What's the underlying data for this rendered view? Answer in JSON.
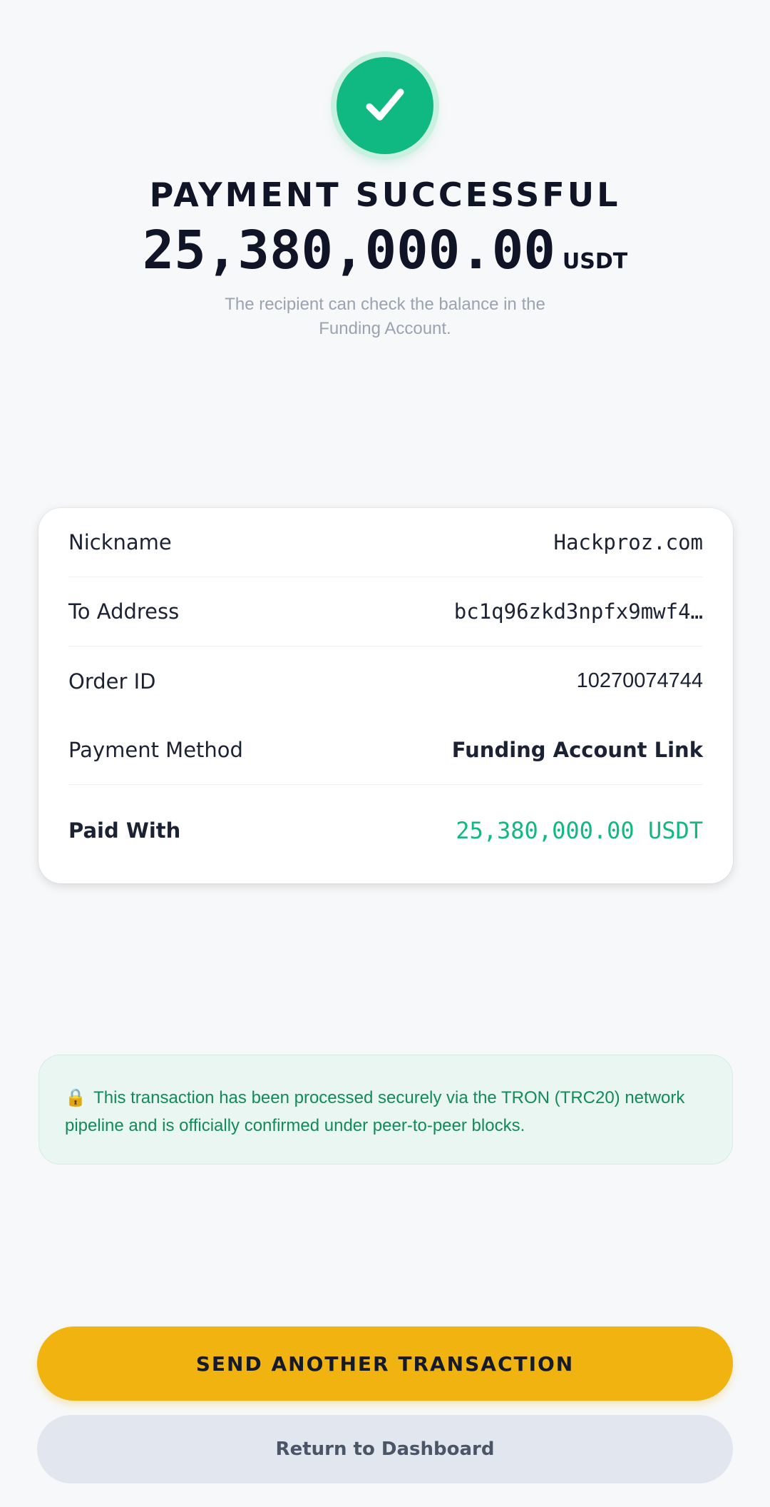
{
  "colors": {
    "accent_green": "#10b981",
    "primary_button": "#f0b30f",
    "secondary_button": "#e2e7ef",
    "notice_bg": "#eaf6f1",
    "notice_text": "#128a5c"
  },
  "header": {
    "icon": "checkmark-icon",
    "title": "PAYMENT SUCCESSFUL",
    "amount": "25,380,000.00",
    "currency": "USDT",
    "subtitle": "The recipient can check the balance in the Funding Account."
  },
  "details": {
    "rows": [
      {
        "label": "Nickname",
        "value": "Hackproz.com"
      },
      {
        "label": "To Address",
        "value": "bc1q96zkd3npfx9mwf4…"
      },
      {
        "label": "Order ID",
        "value": "10270074744"
      },
      {
        "label": "Payment Method",
        "value": "Funding Account Link"
      },
      {
        "label": "Paid With",
        "value": "25,380,000.00 USDT"
      }
    ]
  },
  "notice": {
    "icon": "lock-icon",
    "lock_glyph": "🔒",
    "text": "This transaction has been processed securely via the TRON (TRC20) network pipeline and is officially confirmed under peer-to-peer blocks."
  },
  "actions": {
    "primary_label": "SEND ANOTHER TRANSACTION",
    "secondary_label": "Return to Dashboard"
  }
}
